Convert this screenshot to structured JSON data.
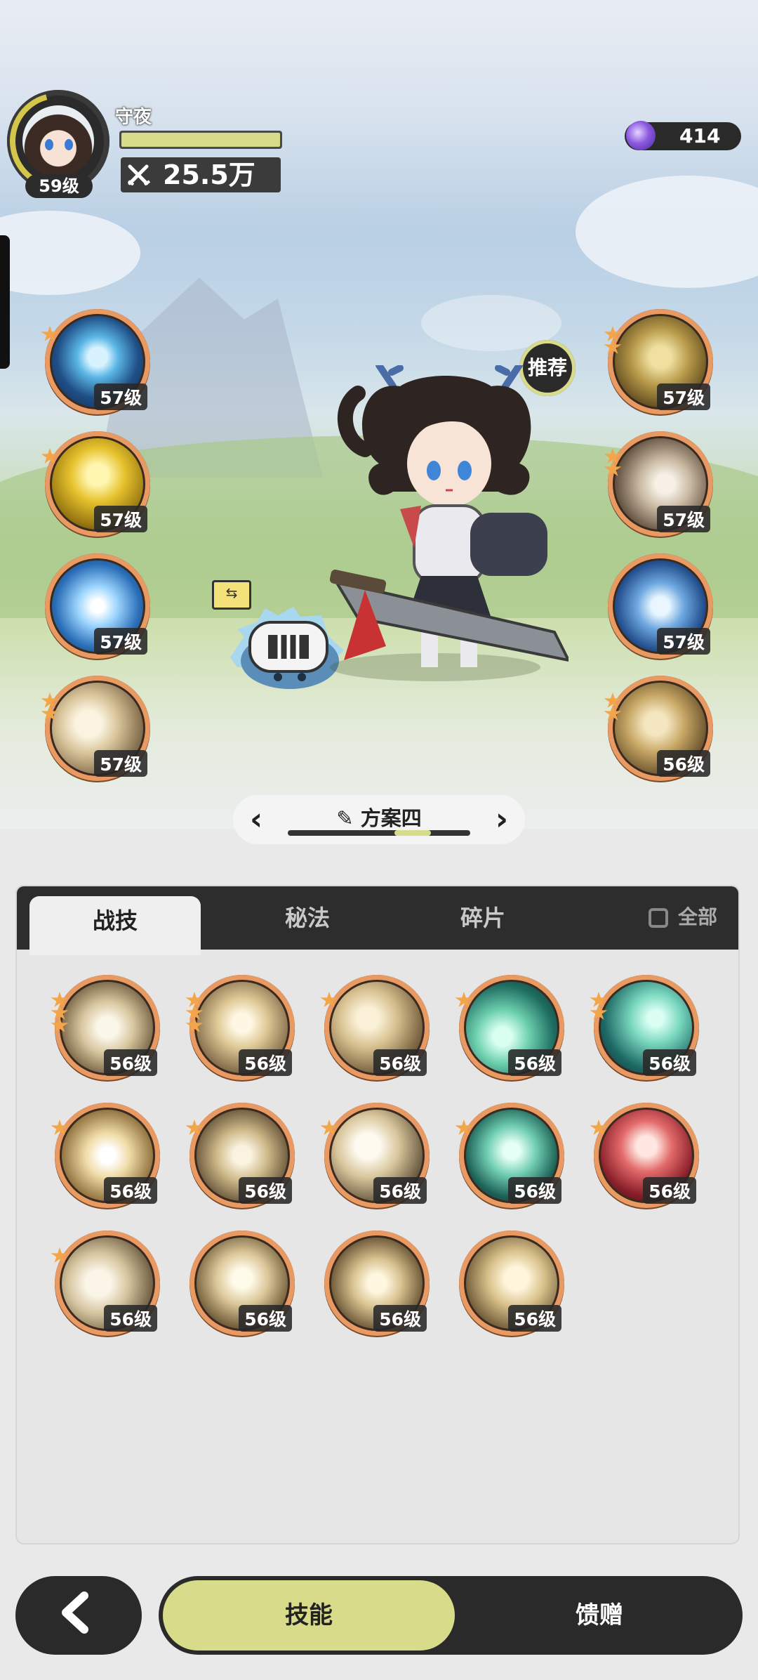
{
  "header": {
    "player_name": "守夜",
    "level_badge": "59级",
    "power_value": "25.5万",
    "currency_amount": "414",
    "exp_fraction": 1.0
  },
  "equipped_left": [
    {
      "level": "57级",
      "stars": 1,
      "theme": "cyan-vortex"
    },
    {
      "level": "57级",
      "stars": 1,
      "theme": "gold-shield"
    },
    {
      "level": "57级",
      "stars": 0,
      "theme": "ice-crystal"
    },
    {
      "level": "57级",
      "stars": 2,
      "theme": "sand-burst"
    }
  ],
  "equipped_right": [
    {
      "level": "57级",
      "stars": 2,
      "theme": "gold-golem"
    },
    {
      "level": "57级",
      "stars": 2,
      "theme": "shield-slash"
    },
    {
      "level": "57级",
      "stars": 0,
      "theme": "blue-shield"
    },
    {
      "level": "56级",
      "stars": 2,
      "theme": "sand-beast"
    }
  ],
  "recommend_label": "推荐",
  "scheme": {
    "title": "方案四",
    "prev": "‹",
    "next": "›"
  },
  "tabs": {
    "tab1": "战技",
    "tab2": "秘法",
    "tab3": "碎片",
    "all_label": "全部"
  },
  "skills_grid": [
    {
      "level": "56级",
      "stars": 3,
      "theme": "sand-wind"
    },
    {
      "level": "56级",
      "stars": 3,
      "theme": "sand-spikes"
    },
    {
      "level": "56级",
      "stars": 1,
      "theme": "sand-moon"
    },
    {
      "level": "56级",
      "stars": 1,
      "theme": "teal-slash"
    },
    {
      "level": "56级",
      "stars": 2,
      "theme": "teal-web"
    },
    {
      "level": "56级",
      "stars": 1,
      "theme": "sand-explode"
    },
    {
      "level": "56级",
      "stars": 1,
      "theme": "sand-swirl"
    },
    {
      "level": "56级",
      "stars": 1,
      "theme": "sand-strike"
    },
    {
      "level": "56级",
      "stars": 1,
      "theme": "teal-sword"
    },
    {
      "level": "56级",
      "stars": 1,
      "theme": "red-warrior"
    },
    {
      "level": "56级",
      "stars": 1,
      "theme": "sand-ghosts"
    },
    {
      "level": "56级",
      "stars": 0,
      "theme": "sand-sparkle"
    },
    {
      "level": "56级",
      "stars": 0,
      "theme": "sand-stars"
    },
    {
      "level": "56级",
      "stars": 0,
      "theme": "sand-wing"
    }
  ],
  "bottom": {
    "skills_label": "技能",
    "gift_label": "馈赠"
  },
  "colors": {
    "accent": "#d8db89",
    "frame": "#e89a62",
    "dark": "#2a2a2a",
    "star": "#f2a54a"
  }
}
